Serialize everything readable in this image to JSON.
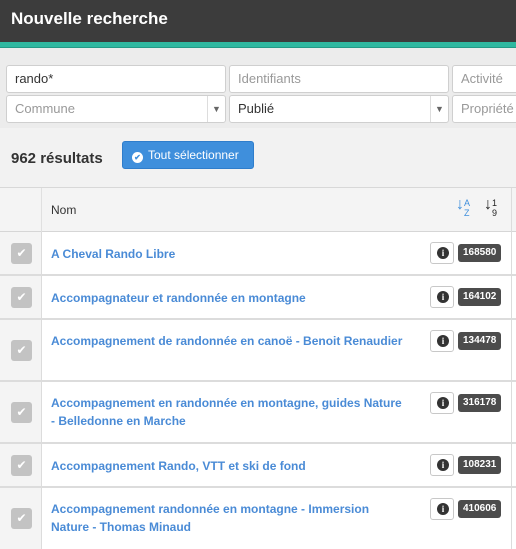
{
  "header": {
    "title": "Nouvelle recherche"
  },
  "filters": {
    "search": {
      "value": "rando*"
    },
    "identifiants": {
      "placeholder": "Identifiants"
    },
    "activite": {
      "placeholder": "Activité"
    },
    "commune": {
      "placeholder": "Commune"
    },
    "statut": {
      "value": "Publié"
    },
    "propriete": {
      "placeholder": "Propriété"
    }
  },
  "results": {
    "count_label": "962 résultats",
    "select_all_label": "Tout sélectionner"
  },
  "table": {
    "header": {
      "name_label": "Nom",
      "sort_alpha": {
        "top": "A",
        "bottom": "Z"
      },
      "sort_num": {
        "top": "1",
        "bottom": "9"
      }
    },
    "rows": [
      {
        "name": "A Cheval Rando Libre",
        "id": "168580"
      },
      {
        "name": "Accompagnateur et randonnée en montagne",
        "id": "164102"
      },
      {
        "name": "Accompagnement de randonnée en canoë - Benoit Renaudier",
        "id": "134478"
      },
      {
        "name": "Accompagnement en randonnée en montagne, guides Nature - Belledonne en Marche",
        "id": "316178"
      },
      {
        "name": "Accompagnement Rando, VTT et ski de fond",
        "id": "108231"
      },
      {
        "name": "Accompagnement randonnée en montagne - Immersion Nature - Thomas Minaud",
        "id": "410606"
      }
    ]
  },
  "colors": {
    "header_bg": "#3c3c3c",
    "accent_teal": "#2fb8a0",
    "link_blue": "#4a8bd6",
    "button_blue": "#3f8fdc"
  },
  "icons": {
    "row_check": "check-icon",
    "info": "info-icon",
    "select_all": "check-circle-icon",
    "sort_alpha": "sort-alpha-icon",
    "sort_num": "sort-numeric-icon",
    "dropdown": "chevron-down-icon"
  }
}
